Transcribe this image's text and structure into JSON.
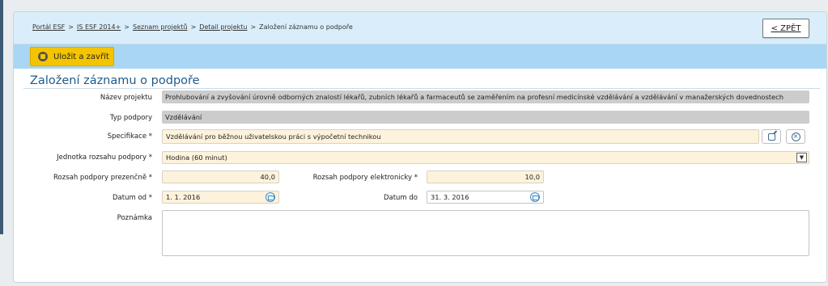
{
  "breadcrumb": {
    "items": [
      "Portál ESF",
      "IS ESF 2014+",
      "Seznam projektů",
      "Detail projektu"
    ],
    "current": "Založení záznamu o podpoře",
    "separator": ">"
  },
  "back_button": "< ZPĚT",
  "toolbar": {
    "save_close": "Uložit a zavřít"
  },
  "page_title": "Založení záznamu o podpoře",
  "form": {
    "project_name_label": "Název projektu",
    "project_name_value": "Prohlubování a zvyšování úrovně odborných znalostí lékařů, zubních lékařů a farmaceutů se zaměřením na profesní medicínské vzdělávání a vzdělávání v manažerských dovednostech",
    "support_type_label": "Typ podpory",
    "support_type_value": "Vzdělávání",
    "specification_label": "Specifikace *",
    "specification_value": "Vzdělávání pro běžnou uživatelskou práci s výpočetní technikou",
    "unit_label": "Jednotka rozsahu podpory *",
    "unit_value": "Hodina (60 minut)",
    "in_person_label": "Rozsah podpory prezenčně *",
    "in_person_value": "40,0",
    "electronic_label": "Rozsah podpory elektronicky *",
    "electronic_value": "10,0",
    "date_from_label": "Datum od *",
    "date_from_value": "1. 1. 2016",
    "date_to_label": "Datum do",
    "date_to_value": "31. 3. 2016",
    "note_label": "Poznámka",
    "note_value": ""
  },
  "colors": {
    "header_band": "#d9eefa",
    "toolbar": "#a9d6f2",
    "save_button": "#f5c400",
    "title": "#1f5a8a",
    "required_field": "#fdf2dc",
    "readonly_field": "#cccccc"
  },
  "icons": [
    "save-icon",
    "calendar-icon",
    "edit-icon",
    "clear-icon",
    "chevron-down-icon"
  ]
}
